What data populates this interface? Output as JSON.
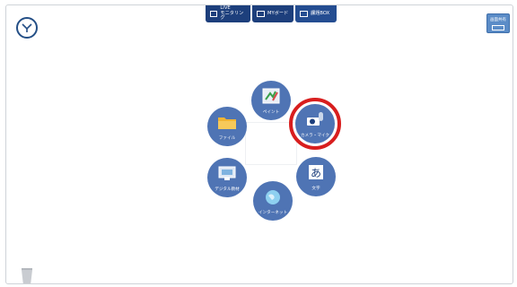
{
  "topbar": {
    "tabs": [
      {
        "label": "LIVE\nモニタリング",
        "icon": "monitor-icon"
      },
      {
        "label": "MYボード",
        "icon": "board-icon"
      },
      {
        "label": "課題BOX",
        "icon": "box-icon"
      }
    ]
  },
  "corner_button": {
    "label": "画面共有"
  },
  "menu": {
    "items": [
      {
        "key": "paint",
        "label": "ペイント",
        "icon": "paint-icon"
      },
      {
        "key": "camera",
        "label": "カメラ・マイク",
        "icon": "camera-mic-icon"
      },
      {
        "key": "file",
        "label": "ファイル",
        "icon": "folder-icon"
      },
      {
        "key": "digital",
        "label": "デジタル教材",
        "icon": "digital-material-icon"
      },
      {
        "key": "text",
        "label": "文字",
        "icon": "text-icon",
        "glyph": "あ"
      },
      {
        "key": "internet",
        "label": "インターネット",
        "icon": "globe-icon"
      }
    ]
  },
  "colors": {
    "accent": "#1d3f7c",
    "menu_circle": "#4f74b4",
    "highlight": "#d81e1e"
  }
}
